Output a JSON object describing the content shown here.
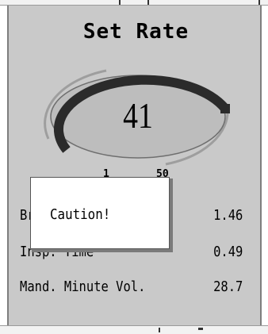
{
  "title": "Set Rate",
  "dial": {
    "value": "41",
    "scale_min": "1",
    "scale_max": "50"
  },
  "caution": {
    "text": "Caution!"
  },
  "readouts": [
    {
      "label": "Br",
      "value": "1.46"
    },
    {
      "label": "Insp. Time",
      "value": "0.49"
    },
    {
      "label": "Mand. Minute Vol.",
      "value": "28.7"
    }
  ],
  "colors": {
    "panel": "#c9c9c9",
    "dial_fill": "#bdbdbd",
    "dial_arc": "#2b2b2b",
    "caution_bg": "#ffffff"
  }
}
